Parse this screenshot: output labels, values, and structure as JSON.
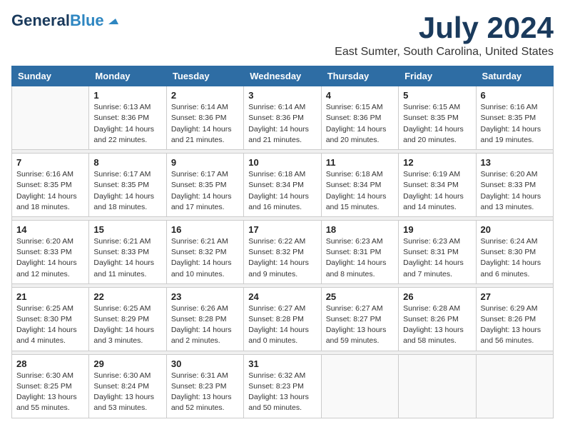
{
  "header": {
    "logo_general": "General",
    "logo_blue": "Blue",
    "month_title": "July 2024",
    "location": "East Sumter, South Carolina, United States"
  },
  "calendar": {
    "days_of_week": [
      "Sunday",
      "Monday",
      "Tuesday",
      "Wednesday",
      "Thursday",
      "Friday",
      "Saturday"
    ],
    "weeks": [
      [
        {
          "day": "",
          "info": ""
        },
        {
          "day": "1",
          "info": "Sunrise: 6:13 AM\nSunset: 8:36 PM\nDaylight: 14 hours\nand 22 minutes."
        },
        {
          "day": "2",
          "info": "Sunrise: 6:14 AM\nSunset: 8:36 PM\nDaylight: 14 hours\nand 21 minutes."
        },
        {
          "day": "3",
          "info": "Sunrise: 6:14 AM\nSunset: 8:36 PM\nDaylight: 14 hours\nand 21 minutes."
        },
        {
          "day": "4",
          "info": "Sunrise: 6:15 AM\nSunset: 8:36 PM\nDaylight: 14 hours\nand 20 minutes."
        },
        {
          "day": "5",
          "info": "Sunrise: 6:15 AM\nSunset: 8:35 PM\nDaylight: 14 hours\nand 20 minutes."
        },
        {
          "day": "6",
          "info": "Sunrise: 6:16 AM\nSunset: 8:35 PM\nDaylight: 14 hours\nand 19 minutes."
        }
      ],
      [
        {
          "day": "7",
          "info": "Sunrise: 6:16 AM\nSunset: 8:35 PM\nDaylight: 14 hours\nand 18 minutes."
        },
        {
          "day": "8",
          "info": "Sunrise: 6:17 AM\nSunset: 8:35 PM\nDaylight: 14 hours\nand 18 minutes."
        },
        {
          "day": "9",
          "info": "Sunrise: 6:17 AM\nSunset: 8:35 PM\nDaylight: 14 hours\nand 17 minutes."
        },
        {
          "day": "10",
          "info": "Sunrise: 6:18 AM\nSunset: 8:34 PM\nDaylight: 14 hours\nand 16 minutes."
        },
        {
          "day": "11",
          "info": "Sunrise: 6:18 AM\nSunset: 8:34 PM\nDaylight: 14 hours\nand 15 minutes."
        },
        {
          "day": "12",
          "info": "Sunrise: 6:19 AM\nSunset: 8:34 PM\nDaylight: 14 hours\nand 14 minutes."
        },
        {
          "day": "13",
          "info": "Sunrise: 6:20 AM\nSunset: 8:33 PM\nDaylight: 14 hours\nand 13 minutes."
        }
      ],
      [
        {
          "day": "14",
          "info": "Sunrise: 6:20 AM\nSunset: 8:33 PM\nDaylight: 14 hours\nand 12 minutes."
        },
        {
          "day": "15",
          "info": "Sunrise: 6:21 AM\nSunset: 8:33 PM\nDaylight: 14 hours\nand 11 minutes."
        },
        {
          "day": "16",
          "info": "Sunrise: 6:21 AM\nSunset: 8:32 PM\nDaylight: 14 hours\nand 10 minutes."
        },
        {
          "day": "17",
          "info": "Sunrise: 6:22 AM\nSunset: 8:32 PM\nDaylight: 14 hours\nand 9 minutes."
        },
        {
          "day": "18",
          "info": "Sunrise: 6:23 AM\nSunset: 8:31 PM\nDaylight: 14 hours\nand 8 minutes."
        },
        {
          "day": "19",
          "info": "Sunrise: 6:23 AM\nSunset: 8:31 PM\nDaylight: 14 hours\nand 7 minutes."
        },
        {
          "day": "20",
          "info": "Sunrise: 6:24 AM\nSunset: 8:30 PM\nDaylight: 14 hours\nand 6 minutes."
        }
      ],
      [
        {
          "day": "21",
          "info": "Sunrise: 6:25 AM\nSunset: 8:30 PM\nDaylight: 14 hours\nand 4 minutes."
        },
        {
          "day": "22",
          "info": "Sunrise: 6:25 AM\nSunset: 8:29 PM\nDaylight: 14 hours\nand 3 minutes."
        },
        {
          "day": "23",
          "info": "Sunrise: 6:26 AM\nSunset: 8:28 PM\nDaylight: 14 hours\nand 2 minutes."
        },
        {
          "day": "24",
          "info": "Sunrise: 6:27 AM\nSunset: 8:28 PM\nDaylight: 14 hours\nand 0 minutes."
        },
        {
          "day": "25",
          "info": "Sunrise: 6:27 AM\nSunset: 8:27 PM\nDaylight: 13 hours\nand 59 minutes."
        },
        {
          "day": "26",
          "info": "Sunrise: 6:28 AM\nSunset: 8:26 PM\nDaylight: 13 hours\nand 58 minutes."
        },
        {
          "day": "27",
          "info": "Sunrise: 6:29 AM\nSunset: 8:26 PM\nDaylight: 13 hours\nand 56 minutes."
        }
      ],
      [
        {
          "day": "28",
          "info": "Sunrise: 6:30 AM\nSunset: 8:25 PM\nDaylight: 13 hours\nand 55 minutes."
        },
        {
          "day": "29",
          "info": "Sunrise: 6:30 AM\nSunset: 8:24 PM\nDaylight: 13 hours\nand 53 minutes."
        },
        {
          "day": "30",
          "info": "Sunrise: 6:31 AM\nSunset: 8:23 PM\nDaylight: 13 hours\nand 52 minutes."
        },
        {
          "day": "31",
          "info": "Sunrise: 6:32 AM\nSunset: 8:23 PM\nDaylight: 13 hours\nand 50 minutes."
        },
        {
          "day": "",
          "info": ""
        },
        {
          "day": "",
          "info": ""
        },
        {
          "day": "",
          "info": ""
        }
      ]
    ]
  }
}
